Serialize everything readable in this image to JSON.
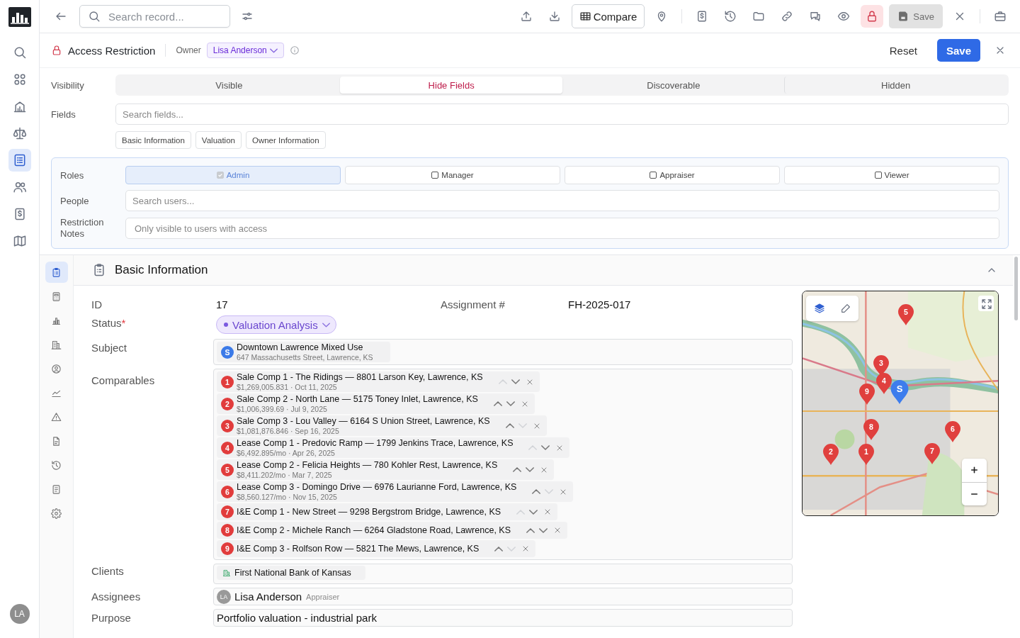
{
  "rail": {
    "items": [
      {
        "selected": false
      },
      {
        "selected": false
      },
      {
        "selected": false
      },
      {
        "selected": false
      },
      {
        "selected": true
      },
      {
        "selected": false
      },
      {
        "selected": false
      },
      {
        "selected": false
      }
    ],
    "avatar": "LA"
  },
  "topbar": {
    "search_placeholder": "Search record...",
    "compare": "Compare",
    "lock_active": true,
    "save": "Save",
    "save_disabled": true
  },
  "access": {
    "title": "Access Restriction",
    "owner_label": "Owner",
    "owner": "Lisa Anderson",
    "reset": "Reset",
    "save": "Save",
    "visibility": {
      "label": "Visibility",
      "options": [
        {
          "label": "Visible",
          "selected": false
        },
        {
          "label": "Hide Fields",
          "selected": true
        },
        {
          "label": "Discoverable",
          "selected": false
        },
        {
          "label": "Hidden",
          "selected": false
        }
      ]
    },
    "fields": {
      "label": "Fields",
      "placeholder": "Search fields...",
      "chips": [
        "Basic Information",
        "Valuation",
        "Owner Information"
      ]
    },
    "roles": {
      "label": "Roles",
      "options": [
        {
          "label": "Admin",
          "checked": true
        },
        {
          "label": "Manager",
          "checked": false
        },
        {
          "label": "Appraiser",
          "checked": false
        },
        {
          "label": "Viewer",
          "checked": false
        }
      ]
    },
    "people": {
      "label": "People",
      "placeholder": "Search users..."
    },
    "notes": {
      "label": "Restriction Notes",
      "placeholder": "Only visible to users with access"
    }
  },
  "section_nav": [
    {
      "selected": true
    },
    {
      "selected": false
    },
    {
      "selected": false
    },
    {
      "selected": false
    },
    {
      "selected": false
    },
    {
      "selected": false
    },
    {
      "selected": false
    },
    {
      "selected": false
    },
    {
      "selected": false
    },
    {
      "selected": false
    },
    {
      "selected": false
    }
  ],
  "section": {
    "title": "Basic Information",
    "expanded": true,
    "id_label": "ID",
    "id": "17",
    "assignment_label": "Assignment #",
    "assignment": "FH-2025-017",
    "status_label": "Status",
    "status_required_mark": "*",
    "status": "Valuation Analysis",
    "subject_label": "Subject",
    "subject": {
      "badge": "S",
      "name": "Downtown Lawrence Mixed Use",
      "address": "647 Massachusetts Street, Lawrence, KS"
    },
    "comparables_label": "Comparables",
    "comparables": [
      {
        "badge": "1",
        "title": "Sale Comp 1 - The Ridings — 8801 Larson Key, Lawrence, KS",
        "detail": "$1,269,005.831 · Oct 11, 2025",
        "up_disabled": true,
        "down_disabled": false
      },
      {
        "badge": "2",
        "title": "Sale Comp 2 - North Lane — 5175 Toney Inlet, Lawrence, KS",
        "detail": "$1,006,399.69 · Jul 9, 2025",
        "up_disabled": false,
        "down_disabled": false
      },
      {
        "badge": "3",
        "title": "Sale Comp 3 - Lou Valley — 6164 S Union Street, Lawrence, KS",
        "detail": "$1,081,876.846 · Sep 16, 2025",
        "up_disabled": false,
        "down_disabled": true
      },
      {
        "badge": "4",
        "title": "Lease Comp 1 - Predovic Ramp — 1799 Jenkins Trace, Lawrence, KS",
        "detail": "$6,492.895/mo · Apr 26, 2025",
        "up_disabled": true,
        "down_disabled": false
      },
      {
        "badge": "5",
        "title": "Lease Comp 2 - Felicia Heights — 780 Kohler Rest, Lawrence, KS",
        "detail": "$8,411.202/mo · Mar 7, 2025",
        "up_disabled": false,
        "down_disabled": false
      },
      {
        "badge": "6",
        "title": "Lease Comp 3 - Domingo Drive — 6976 Laurianne Ford, Lawrence, KS",
        "detail": "$8,560.127/mo · Nov 15, 2025",
        "up_disabled": false,
        "down_disabled": true
      },
      {
        "badge": "7",
        "title": "I&E Comp 1 - New Street — 9298 Bergstrom Bridge, Lawrence, KS",
        "up_disabled": true,
        "down_disabled": false
      },
      {
        "badge": "8",
        "title": "I&E Comp 2 - Michele Ranch — 6264 Gladstone Road, Lawrence, KS",
        "up_disabled": false,
        "down_disabled": false
      },
      {
        "badge": "9",
        "title": "I&E Comp 3 - Rolfson Row — 5821 The Mews, Lawrence, KS",
        "up_disabled": false,
        "down_disabled": true
      }
    ],
    "clients_label": "Clients",
    "client": "First National Bank of Kansas",
    "assignees_label": "Assignees",
    "assignee": {
      "initials": "LA",
      "name": "Lisa Anderson",
      "role": "Appraiser"
    },
    "purpose_label": "Purpose",
    "purpose": "Portfolio valuation - industrial park",
    "map": {
      "kind": "picture",
      "markers": [
        {
          "label": "5",
          "kind": "comp"
        },
        {
          "label": "3",
          "kind": "comp"
        },
        {
          "label": "4",
          "kind": "comp"
        },
        {
          "label": "9",
          "kind": "comp"
        },
        {
          "label": "S",
          "kind": "subject"
        },
        {
          "label": "8",
          "kind": "comp"
        },
        {
          "label": "6",
          "kind": "comp"
        },
        {
          "label": "2",
          "kind": "comp"
        },
        {
          "label": "1",
          "kind": "comp"
        },
        {
          "label": "7",
          "kind": "comp"
        }
      ]
    }
  }
}
